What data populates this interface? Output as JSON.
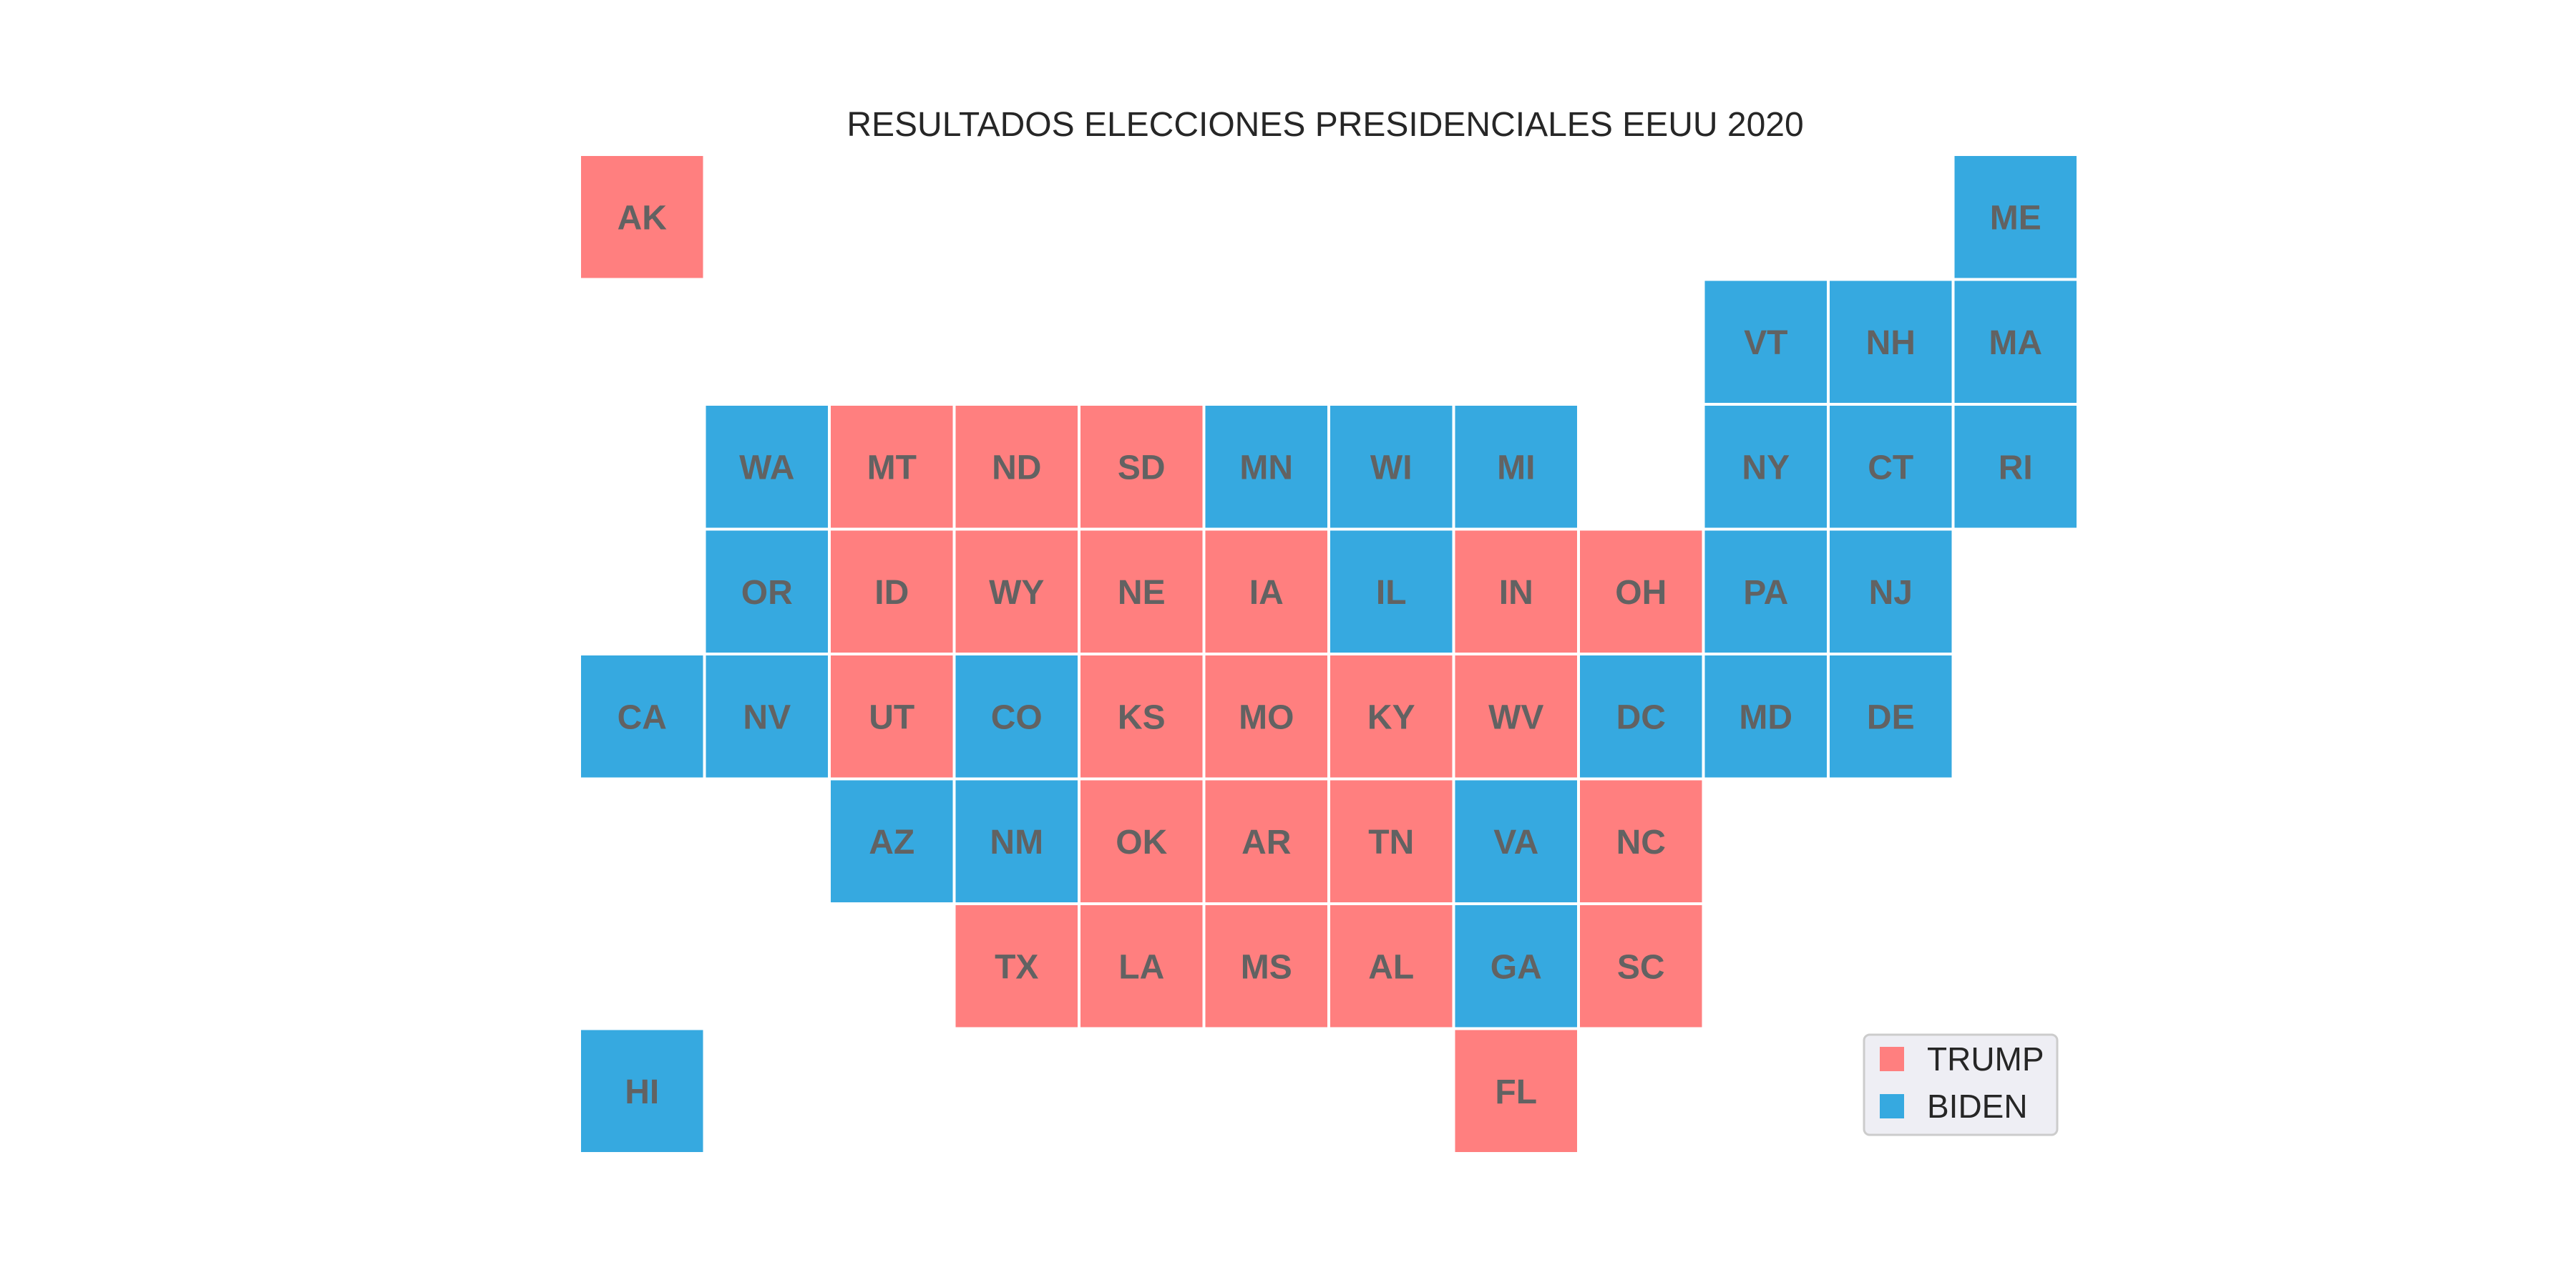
{
  "chart_data": {
    "type": "heatmap",
    "title": "RESULTADOS ELECCIONES PRESIDENCIALES EEUU 2020",
    "xlabel": "",
    "ylabel": "",
    "grid": false,
    "legend_position": "bottom-right",
    "series": [
      {
        "name": "TRUMP",
        "color": "#FF7F7F"
      },
      {
        "name": "BIDEN",
        "color": "#36A9E0"
      }
    ],
    "tiles": [
      {
        "state": "AK",
        "col": 0,
        "row": 0,
        "winner": "TRUMP"
      },
      {
        "state": "ME",
        "col": 11,
        "row": 0,
        "winner": "BIDEN"
      },
      {
        "state": "VT",
        "col": 9,
        "row": 1,
        "winner": "BIDEN"
      },
      {
        "state": "NH",
        "col": 10,
        "row": 1,
        "winner": "BIDEN"
      },
      {
        "state": "MA",
        "col": 11,
        "row": 1,
        "winner": "BIDEN"
      },
      {
        "state": "WA",
        "col": 1,
        "row": 2,
        "winner": "BIDEN"
      },
      {
        "state": "MT",
        "col": 2,
        "row": 2,
        "winner": "TRUMP"
      },
      {
        "state": "ND",
        "col": 3,
        "row": 2,
        "winner": "TRUMP"
      },
      {
        "state": "SD",
        "col": 4,
        "row": 2,
        "winner": "TRUMP"
      },
      {
        "state": "MN",
        "col": 5,
        "row": 2,
        "winner": "BIDEN"
      },
      {
        "state": "WI",
        "col": 6,
        "row": 2,
        "winner": "BIDEN"
      },
      {
        "state": "MI",
        "col": 7,
        "row": 2,
        "winner": "BIDEN"
      },
      {
        "state": "NY",
        "col": 9,
        "row": 2,
        "winner": "BIDEN"
      },
      {
        "state": "CT",
        "col": 10,
        "row": 2,
        "winner": "BIDEN"
      },
      {
        "state": "RI",
        "col": 11,
        "row": 2,
        "winner": "BIDEN"
      },
      {
        "state": "OR",
        "col": 1,
        "row": 3,
        "winner": "BIDEN"
      },
      {
        "state": "ID",
        "col": 2,
        "row": 3,
        "winner": "TRUMP"
      },
      {
        "state": "WY",
        "col": 3,
        "row": 3,
        "winner": "TRUMP"
      },
      {
        "state": "NE",
        "col": 4,
        "row": 3,
        "winner": "TRUMP"
      },
      {
        "state": "IA",
        "col": 5,
        "row": 3,
        "winner": "TRUMP"
      },
      {
        "state": "IL",
        "col": 6,
        "row": 3,
        "winner": "BIDEN"
      },
      {
        "state": "IN",
        "col": 7,
        "row": 3,
        "winner": "TRUMP"
      },
      {
        "state": "OH",
        "col": 8,
        "row": 3,
        "winner": "TRUMP"
      },
      {
        "state": "PA",
        "col": 9,
        "row": 3,
        "winner": "BIDEN"
      },
      {
        "state": "NJ",
        "col": 10,
        "row": 3,
        "winner": "BIDEN"
      },
      {
        "state": "CA",
        "col": 0,
        "row": 4,
        "winner": "BIDEN"
      },
      {
        "state": "NV",
        "col": 1,
        "row": 4,
        "winner": "BIDEN"
      },
      {
        "state": "UT",
        "col": 2,
        "row": 4,
        "winner": "TRUMP"
      },
      {
        "state": "CO",
        "col": 3,
        "row": 4,
        "winner": "BIDEN"
      },
      {
        "state": "KS",
        "col": 4,
        "row": 4,
        "winner": "TRUMP"
      },
      {
        "state": "MO",
        "col": 5,
        "row": 4,
        "winner": "TRUMP"
      },
      {
        "state": "KY",
        "col": 6,
        "row": 4,
        "winner": "TRUMP"
      },
      {
        "state": "WV",
        "col": 7,
        "row": 4,
        "winner": "TRUMP"
      },
      {
        "state": "DC",
        "col": 8,
        "row": 4,
        "winner": "BIDEN"
      },
      {
        "state": "MD",
        "col": 9,
        "row": 4,
        "winner": "BIDEN"
      },
      {
        "state": "DE",
        "col": 10,
        "row": 4,
        "winner": "BIDEN"
      },
      {
        "state": "AZ",
        "col": 2,
        "row": 5,
        "winner": "BIDEN"
      },
      {
        "state": "NM",
        "col": 3,
        "row": 5,
        "winner": "BIDEN"
      },
      {
        "state": "OK",
        "col": 4,
        "row": 5,
        "winner": "TRUMP"
      },
      {
        "state": "AR",
        "col": 5,
        "row": 5,
        "winner": "TRUMP"
      },
      {
        "state": "TN",
        "col": 6,
        "row": 5,
        "winner": "TRUMP"
      },
      {
        "state": "VA",
        "col": 7,
        "row": 5,
        "winner": "BIDEN"
      },
      {
        "state": "NC",
        "col": 8,
        "row": 5,
        "winner": "TRUMP"
      },
      {
        "state": "TX",
        "col": 3,
        "row": 6,
        "winner": "TRUMP"
      },
      {
        "state": "LA",
        "col": 4,
        "row": 6,
        "winner": "TRUMP"
      },
      {
        "state": "MS",
        "col": 5,
        "row": 6,
        "winner": "TRUMP"
      },
      {
        "state": "AL",
        "col": 6,
        "row": 6,
        "winner": "TRUMP"
      },
      {
        "state": "GA",
        "col": 7,
        "row": 6,
        "winner": "BIDEN"
      },
      {
        "state": "SC",
        "col": 8,
        "row": 6,
        "winner": "TRUMP"
      },
      {
        "state": "HI",
        "col": 0,
        "row": 7,
        "winner": "BIDEN"
      },
      {
        "state": "FL",
        "col": 7,
        "row": 7,
        "winner": "TRUMP"
      }
    ]
  }
}
